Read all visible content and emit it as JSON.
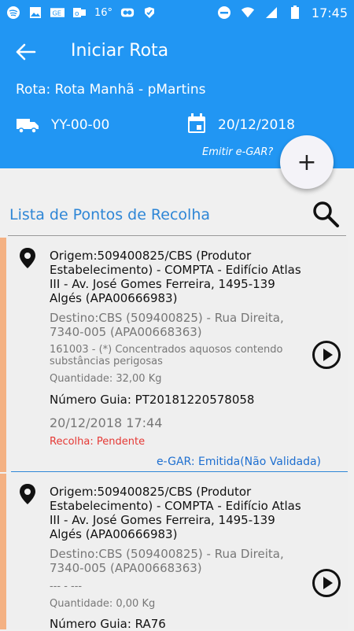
{
  "status_bar": {
    "left_icons": [
      "spotify-icon",
      "image-icon",
      "ge-icon",
      "outlook-icon",
      "weather-icon",
      "owl-icon",
      "check-icon"
    ],
    "temp": "16°",
    "time": "17:45"
  },
  "header": {
    "title": "Iniciar Rota",
    "route": "Rota: Rota Manhã - pMartins",
    "plate": "YY-00-00",
    "date": "20/12/2018",
    "emit_link": "Emitir e-GAR?"
  },
  "fab_label": "+",
  "list": {
    "title": "Lista de Pontos de Recolha",
    "items": [
      {
        "origem": "Origem:509400825/CBS (Produtor Estabelecimento) - COMPTA - Edifício Atlas III - Av. José Gomes Ferreira, 1495-139 Algés (APA00666983)",
        "destino": "Destino:CBS (509400825) - Rua Direita, 7340-005 (APA00668363)",
        "produto": "161003 - (*) Concentrados aquosos contendo substâncias perigosas",
        "quantidade": "Quantidade: 32,00 Kg",
        "guia": "Número Guia: PT20181220578058",
        "datetime": "20/12/2018 17:44",
        "recolha": "Recolha: Pendente",
        "egar": "e-GAR: Emitida(Não Validada)"
      },
      {
        "origem": "Origem:509400825/CBS (Produtor Estabelecimento) - COMPTA - Edifício Atlas III - Av. José Gomes Ferreira, 1495-139 Algés (APA00666983)",
        "destino": "Destino:CBS (509400825) - Rua Direita, 7340-005 (APA00668363)",
        "produto": "--- - ---",
        "quantidade": "Quantidade: 0,00 Kg",
        "guia": "Número Guia: RA76"
      }
    ]
  },
  "colors": {
    "primary": "#2196f3",
    "accent_text": "#2e86d6",
    "status_pending": "#e53935",
    "left_bar": "#f4b183"
  }
}
